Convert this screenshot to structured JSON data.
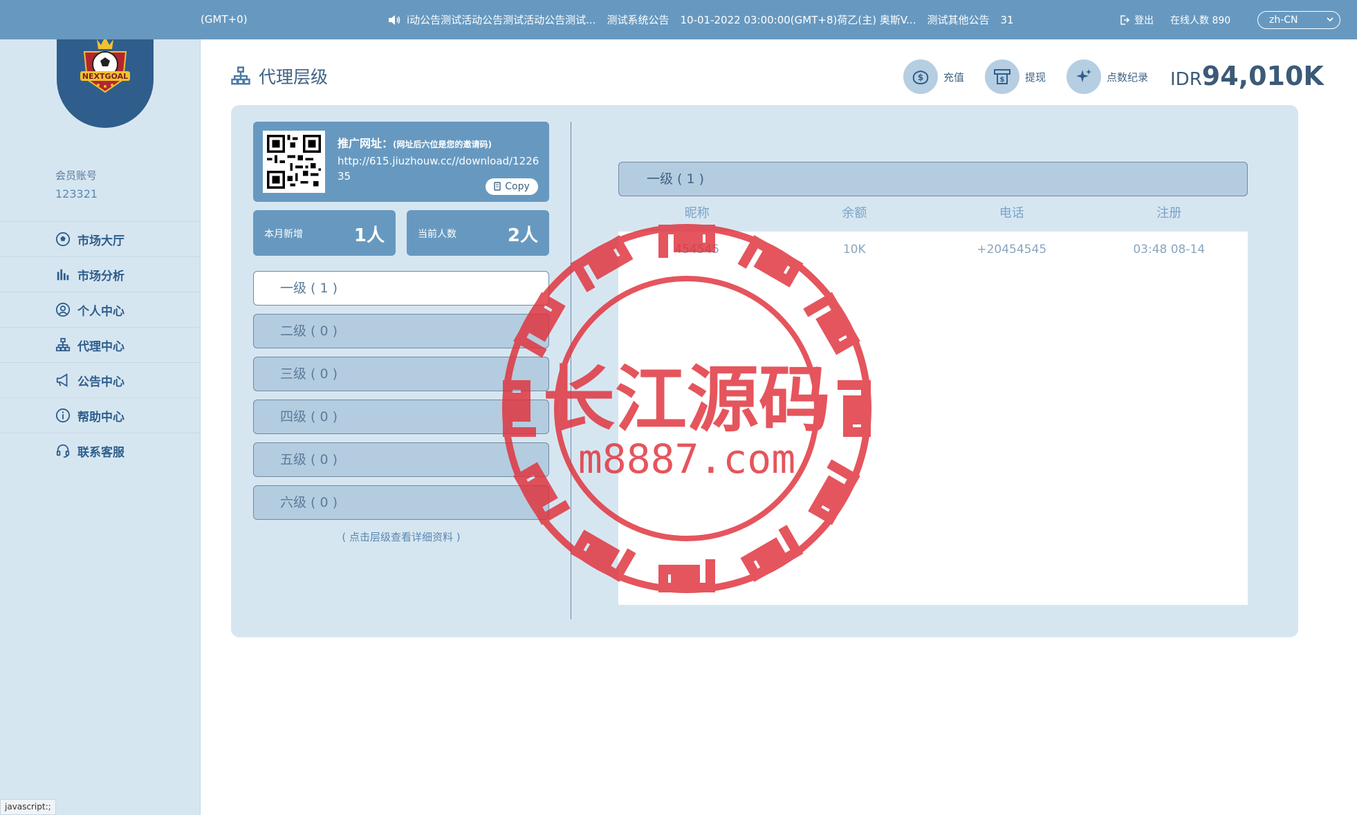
{
  "topbar": {
    "timezone": "(GMT+0)",
    "announcements": [
      "i动公告测试活动公告测试活动公告测试...",
      "测试系统公告",
      "10-01-2022 03:00:00(GMT+8)荷乙(主) 奥斯V...",
      "测试其他公告",
      "31"
    ],
    "logout_label": "登出",
    "online_label": "在线人数 890",
    "language": "zh-CN"
  },
  "sidebar": {
    "logo_text": "NEXTGOAL",
    "member_label": "会员账号",
    "member_id": "123321",
    "items": [
      {
        "label": "市场大厅",
        "icon": "soccer-ball-icon"
      },
      {
        "label": "市场分析",
        "icon": "bar-chart-icon"
      },
      {
        "label": "个人中心",
        "icon": "user-circle-icon"
      },
      {
        "label": "代理中心",
        "icon": "hierarchy-icon"
      },
      {
        "label": "公告中心",
        "icon": "megaphone-icon"
      },
      {
        "label": "帮助中心",
        "icon": "info-icon"
      },
      {
        "label": "联系客服",
        "icon": "headset-icon"
      }
    ]
  },
  "header": {
    "title": "代理层级",
    "actions": [
      {
        "label": "充值",
        "icon": "deposit-icon"
      },
      {
        "label": "提现",
        "icon": "withdraw-icon"
      },
      {
        "label": "点数纪录",
        "icon": "sparkle-icon"
      }
    ],
    "balance_currency": "IDR",
    "balance_amount": "94,010K"
  },
  "promo": {
    "title": "推广网址：",
    "subtitle": "(网址后六位是您的邀请码)",
    "url": "http://615.jiuzhouw.cc//download/122635",
    "copy_label": "Copy"
  },
  "stats": {
    "month_new_label": "本月新增",
    "month_new_value": "1人",
    "current_label": "当前人数",
    "current_value": "2人"
  },
  "levels": [
    {
      "label": "一级 ( 1 )",
      "active": true
    },
    {
      "label": "二级 ( 0 )",
      "active": false
    },
    {
      "label": "三级 ( 0 )",
      "active": false
    },
    {
      "label": "四级 ( 0 )",
      "active": false
    },
    {
      "label": "五级 ( 0 )",
      "active": false
    },
    {
      "label": "六级 ( 0 )",
      "active": false
    }
  ],
  "levels_hint": "( 点击层级查看详细资料 )",
  "detail": {
    "header": "一级 ( 1 )",
    "columns": [
      "昵称",
      "余额",
      "电话",
      "注册"
    ],
    "rows": [
      [
        "454545",
        "10K",
        "+20454545",
        "03:48 08-14"
      ]
    ]
  },
  "watermark": {
    "line1": "长江源码",
    "line2": "m8887.com"
  },
  "statusbar": "javascript:;",
  "colors": {
    "topbar": "#6799c0",
    "sidebar": "#d6e6f1",
    "accent_dark": "#2f5e8c",
    "stamp_red": "#e0303a"
  }
}
